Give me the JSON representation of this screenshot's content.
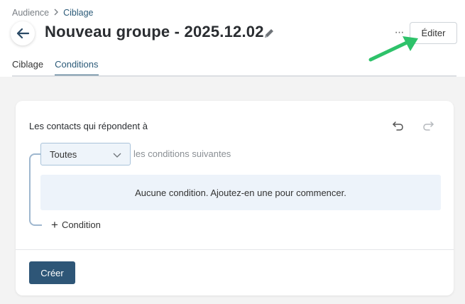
{
  "breadcrumb": {
    "parent": "Audience",
    "current": "Ciblage"
  },
  "header": {
    "title": "Nouveau groupe - 2025.12.02",
    "edit_label": "Éditer",
    "more_label": "···"
  },
  "tabs": [
    {
      "label": "Ciblage",
      "active": false
    },
    {
      "label": "Conditions",
      "active": true
    }
  ],
  "conditions": {
    "card_title": "Les contacts qui répondent à",
    "match_select": {
      "value": "Toutes",
      "options": [
        "Toutes"
      ]
    },
    "match_suffix": "les conditions suivantes",
    "empty_message": "Aucune condition. Ajoutez-en une pour commencer.",
    "add_condition_label": "Condition",
    "create_label": "Créer"
  },
  "icons": [
    "back-arrow-icon",
    "pencil-icon",
    "more-icon",
    "undo-icon",
    "redo-icon",
    "chevron-down-icon",
    "plus-icon",
    "annotation-arrow-icon"
  ],
  "colors": {
    "accent": "#2b5a78",
    "primary_button": "#2e5677",
    "annotation_arrow": "#2ec26a",
    "select_bg": "#eef4fa",
    "bracket": "#9fb7cf"
  }
}
